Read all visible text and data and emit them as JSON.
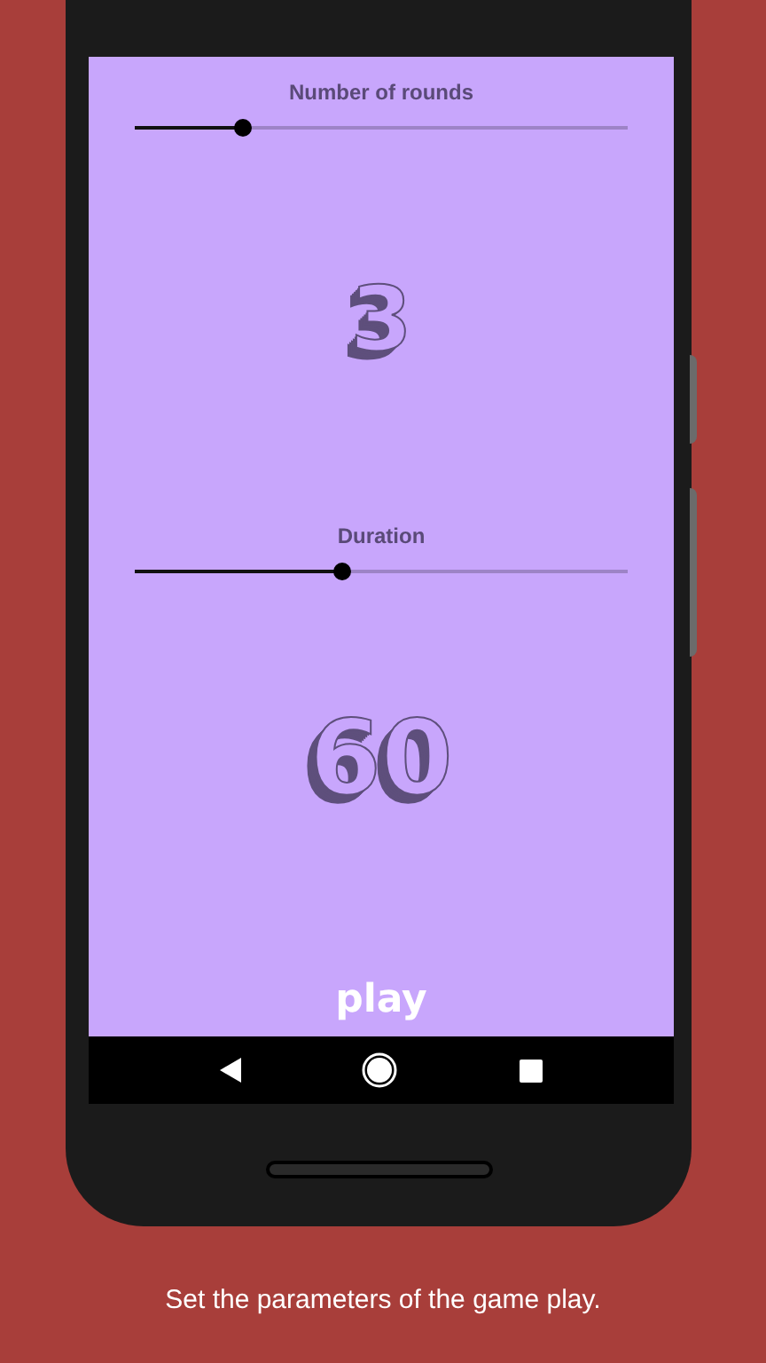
{
  "settings": [
    {
      "label": "Number of rounds",
      "level": 0.22,
      "value": "3"
    },
    {
      "label": "Duration",
      "level": 0.42,
      "value": "60"
    }
  ],
  "play_button": "play",
  "caption": "Set the parameters of the game play."
}
